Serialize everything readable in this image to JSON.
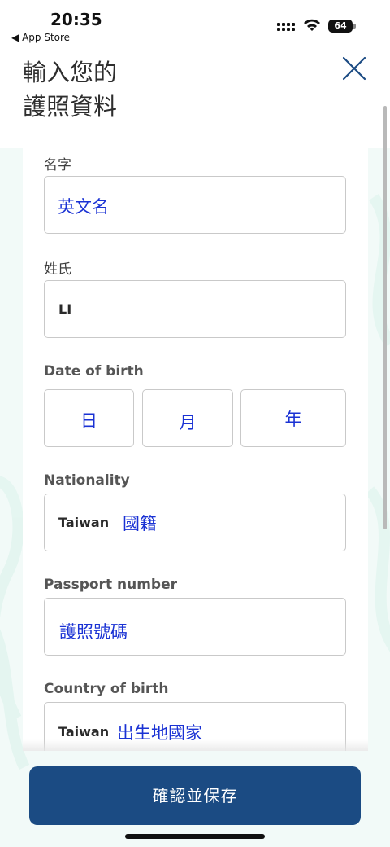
{
  "status_bar": {
    "time": "20:35",
    "back_app": "App Store",
    "battery": "64"
  },
  "header": {
    "title_line1": "輸入您的",
    "title_line2": "護照資料",
    "close_icon": "close-icon"
  },
  "form": {
    "first_name": {
      "label": "名字",
      "value": "英文名"
    },
    "last_name": {
      "label": "姓氏",
      "value": "LI"
    },
    "dob": {
      "label": "Date of birth",
      "day": "日",
      "month": "月",
      "year": "年"
    },
    "nationality": {
      "label": "Nationality",
      "value": "Taiwan",
      "annotation": "國籍"
    },
    "passport": {
      "label": "Passport number",
      "value": "護照號碼"
    },
    "birth_country": {
      "label": "Country of birth",
      "value": "Taiwan",
      "annotation": "出生地國家"
    }
  },
  "confirm_button": "確認並保存",
  "colors": {
    "primary": "#1b4b83",
    "annotation_blue": "#1a32d4",
    "background_tint": "#f2faf8"
  }
}
